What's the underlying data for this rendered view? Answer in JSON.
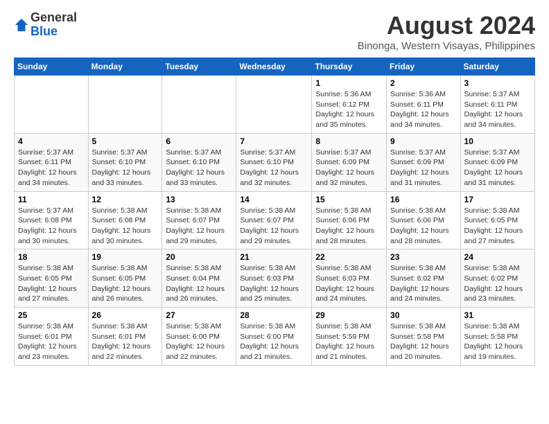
{
  "header": {
    "logo_general": "General",
    "logo_blue": "Blue",
    "month_title": "August 2024",
    "location": "Binonga, Western Visayas, Philippines"
  },
  "weekdays": [
    "Sunday",
    "Monday",
    "Tuesday",
    "Wednesday",
    "Thursday",
    "Friday",
    "Saturday"
  ],
  "weeks": [
    [
      {
        "day": "",
        "info": ""
      },
      {
        "day": "",
        "info": ""
      },
      {
        "day": "",
        "info": ""
      },
      {
        "day": "",
        "info": ""
      },
      {
        "day": "1",
        "info": "Sunrise: 5:36 AM\nSunset: 6:12 PM\nDaylight: 12 hours\nand 35 minutes."
      },
      {
        "day": "2",
        "info": "Sunrise: 5:36 AM\nSunset: 6:11 PM\nDaylight: 12 hours\nand 34 minutes."
      },
      {
        "day": "3",
        "info": "Sunrise: 5:37 AM\nSunset: 6:11 PM\nDaylight: 12 hours\nand 34 minutes."
      }
    ],
    [
      {
        "day": "4",
        "info": "Sunrise: 5:37 AM\nSunset: 6:11 PM\nDaylight: 12 hours\nand 34 minutes."
      },
      {
        "day": "5",
        "info": "Sunrise: 5:37 AM\nSunset: 6:10 PM\nDaylight: 12 hours\nand 33 minutes."
      },
      {
        "day": "6",
        "info": "Sunrise: 5:37 AM\nSunset: 6:10 PM\nDaylight: 12 hours\nand 33 minutes."
      },
      {
        "day": "7",
        "info": "Sunrise: 5:37 AM\nSunset: 6:10 PM\nDaylight: 12 hours\nand 32 minutes."
      },
      {
        "day": "8",
        "info": "Sunrise: 5:37 AM\nSunset: 6:09 PM\nDaylight: 12 hours\nand 32 minutes."
      },
      {
        "day": "9",
        "info": "Sunrise: 5:37 AM\nSunset: 6:09 PM\nDaylight: 12 hours\nand 31 minutes."
      },
      {
        "day": "10",
        "info": "Sunrise: 5:37 AM\nSunset: 6:09 PM\nDaylight: 12 hours\nand 31 minutes."
      }
    ],
    [
      {
        "day": "11",
        "info": "Sunrise: 5:37 AM\nSunset: 6:08 PM\nDaylight: 12 hours\nand 30 minutes."
      },
      {
        "day": "12",
        "info": "Sunrise: 5:38 AM\nSunset: 6:08 PM\nDaylight: 12 hours\nand 30 minutes."
      },
      {
        "day": "13",
        "info": "Sunrise: 5:38 AM\nSunset: 6:07 PM\nDaylight: 12 hours\nand 29 minutes."
      },
      {
        "day": "14",
        "info": "Sunrise: 5:38 AM\nSunset: 6:07 PM\nDaylight: 12 hours\nand 29 minutes."
      },
      {
        "day": "15",
        "info": "Sunrise: 5:38 AM\nSunset: 6:06 PM\nDaylight: 12 hours\nand 28 minutes."
      },
      {
        "day": "16",
        "info": "Sunrise: 5:38 AM\nSunset: 6:06 PM\nDaylight: 12 hours\nand 28 minutes."
      },
      {
        "day": "17",
        "info": "Sunrise: 5:38 AM\nSunset: 6:05 PM\nDaylight: 12 hours\nand 27 minutes."
      }
    ],
    [
      {
        "day": "18",
        "info": "Sunrise: 5:38 AM\nSunset: 6:05 PM\nDaylight: 12 hours\nand 27 minutes."
      },
      {
        "day": "19",
        "info": "Sunrise: 5:38 AM\nSunset: 6:05 PM\nDaylight: 12 hours\nand 26 minutes."
      },
      {
        "day": "20",
        "info": "Sunrise: 5:38 AM\nSunset: 6:04 PM\nDaylight: 12 hours\nand 26 minutes."
      },
      {
        "day": "21",
        "info": "Sunrise: 5:38 AM\nSunset: 6:03 PM\nDaylight: 12 hours\nand 25 minutes."
      },
      {
        "day": "22",
        "info": "Sunrise: 5:38 AM\nSunset: 6:03 PM\nDaylight: 12 hours\nand 24 minutes."
      },
      {
        "day": "23",
        "info": "Sunrise: 5:38 AM\nSunset: 6:02 PM\nDaylight: 12 hours\nand 24 minutes."
      },
      {
        "day": "24",
        "info": "Sunrise: 5:38 AM\nSunset: 6:02 PM\nDaylight: 12 hours\nand 23 minutes."
      }
    ],
    [
      {
        "day": "25",
        "info": "Sunrise: 5:38 AM\nSunset: 6:01 PM\nDaylight: 12 hours\nand 23 minutes."
      },
      {
        "day": "26",
        "info": "Sunrise: 5:38 AM\nSunset: 6:01 PM\nDaylight: 12 hours\nand 22 minutes."
      },
      {
        "day": "27",
        "info": "Sunrise: 5:38 AM\nSunset: 6:00 PM\nDaylight: 12 hours\nand 22 minutes."
      },
      {
        "day": "28",
        "info": "Sunrise: 5:38 AM\nSunset: 6:00 PM\nDaylight: 12 hours\nand 21 minutes."
      },
      {
        "day": "29",
        "info": "Sunrise: 5:38 AM\nSunset: 5:59 PM\nDaylight: 12 hours\nand 21 minutes."
      },
      {
        "day": "30",
        "info": "Sunrise: 5:38 AM\nSunset: 5:58 PM\nDaylight: 12 hours\nand 20 minutes."
      },
      {
        "day": "31",
        "info": "Sunrise: 5:38 AM\nSunset: 5:58 PM\nDaylight: 12 hours\nand 19 minutes."
      }
    ]
  ]
}
